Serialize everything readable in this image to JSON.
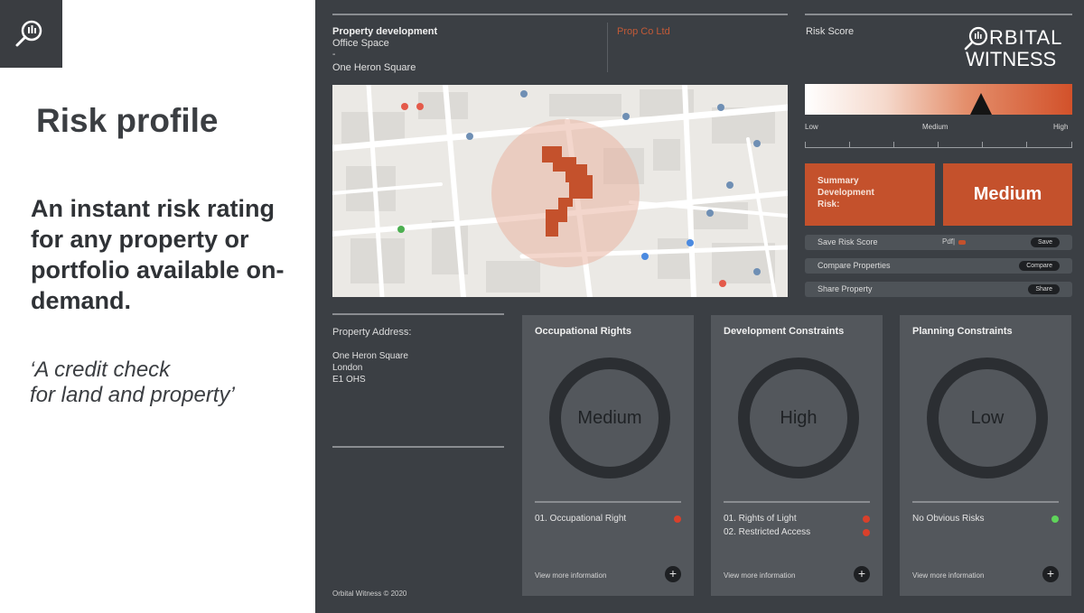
{
  "slide": {
    "title": "Risk profile",
    "tagline": "An instant risk rating for any property or portfolio available on-demand.",
    "quote_line1": "‘A credit check",
    "quote_line2": "for land and property’"
  },
  "header": {
    "property_type_label": "Property development",
    "property_type": "Office Space",
    "separator": "-",
    "property_name": "One Heron Square",
    "company": "Prop Co Ltd",
    "risk_score_label": "Risk Score",
    "brand_line1": "RBITAL",
    "brand_line2": "WITNESS"
  },
  "gauge": {
    "low_label": "Low",
    "medium_label": "Medium",
    "high_label": "High",
    "level": 0.66
  },
  "summary": {
    "label": "Summary Development Risk:",
    "value": "Medium"
  },
  "actions": [
    {
      "label": "Save Risk Score",
      "extra": "Pdf|",
      "button": "Save"
    },
    {
      "label": "Compare Properties",
      "button": "Compare"
    },
    {
      "label": "Share Property",
      "button": "Share"
    }
  ],
  "address": {
    "label": "Property Address:",
    "line1": "One Heron Square",
    "line2": "London",
    "line3": "E1 OHS"
  },
  "cards": [
    {
      "title": "Occupational Rights",
      "rating": "Medium",
      "items": [
        {
          "text": "01. Occupational Right",
          "status": "red"
        }
      ],
      "more": "View more information"
    },
    {
      "title": "Development Constraints",
      "rating": "High",
      "items": [
        {
          "text": "01. Rights of Light",
          "status": "red"
        },
        {
          "text": "02. Restricted Access",
          "status": "red"
        }
      ],
      "more": "View more information"
    },
    {
      "title": "Planning Constraints",
      "rating": "Low",
      "items": [
        {
          "text": "No Obvious Risks",
          "status": "green"
        }
      ],
      "more": "View more information"
    }
  ],
  "footer": {
    "copyright": "Orbital Witness © 2020"
  },
  "colors": {
    "accent": "#c4512c",
    "panel": "#3b3f44",
    "card": "#53575c",
    "status_red": "#d9402b",
    "status_green": "#5fd45a"
  },
  "icons": {
    "slide_logo": "search-icon",
    "brand_logo": "orbital-magnifier-icon",
    "map_pin": "map-pin-icon",
    "card_more": "plus-icon"
  }
}
